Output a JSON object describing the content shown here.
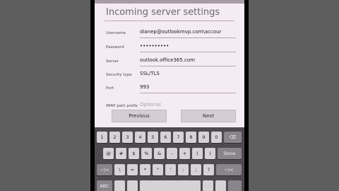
{
  "screen": {
    "title": "Incoming server settings",
    "fields": [
      {
        "label": "Username",
        "value": "dianep@outlookmvp.com\\accour",
        "placeholder": false
      },
      {
        "label": "Password",
        "value": "••••••••••",
        "placeholder": false
      },
      {
        "label": "Server",
        "value": "outlook.office365.com",
        "placeholder": false
      },
      {
        "label": "Security type",
        "value": "SSL/TLS",
        "placeholder": false
      },
      {
        "label": "Port",
        "value": "993",
        "placeholder": false
      },
      {
        "label": "IMAP path prefix",
        "value": "Optional",
        "placeholder": true
      }
    ],
    "buttons": {
      "previous": "Previous",
      "next": "Next"
    }
  },
  "keyboard": {
    "row1": [
      "1",
      "2",
      "3",
      "4",
      "5",
      "6",
      "7",
      "8",
      "9",
      "0",
      "⌫"
    ],
    "row2": [
      "@",
      "#",
      "$",
      "%",
      "&",
      "-",
      "+",
      "(",
      ")",
      "Done"
    ],
    "row3": [
      "~|<",
      "\\",
      "=",
      "*",
      "\"",
      "'",
      ":",
      ";",
      "?",
      "~|<"
    ],
    "row4": [
      "ABC",
      "",
      "",
      "",
      "",
      "",
      ""
    ]
  }
}
